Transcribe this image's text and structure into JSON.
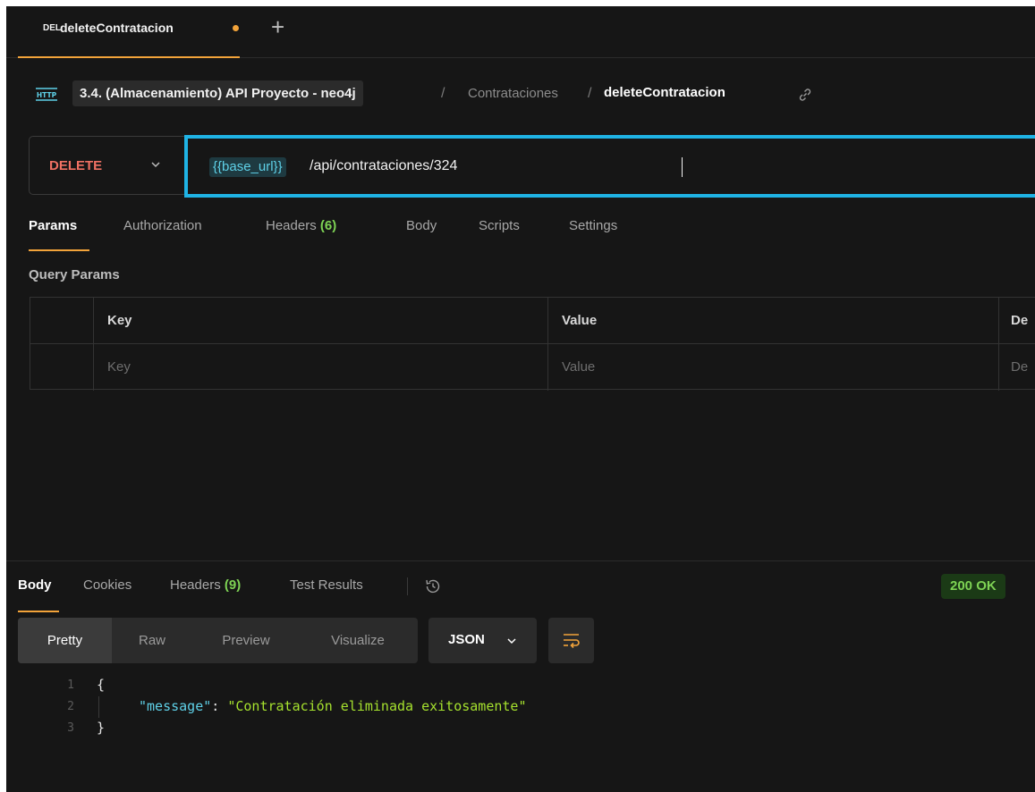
{
  "tab": {
    "method": "DEL",
    "title": "deleteContratacion",
    "new_tab": "+"
  },
  "breadcrumb": {
    "collection": "3.4. (Almacenamiento) API Proyecto - neo4j",
    "separator": "/",
    "folder": "Contrataciones",
    "request": "deleteContratacion"
  },
  "request": {
    "method": "DELETE",
    "url_variable": "{{base_url}}",
    "url_path": "/api/contrataciones/324"
  },
  "request_tabs": [
    {
      "label": "Params"
    },
    {
      "label": "Authorization"
    },
    {
      "label": "Headers",
      "count": "(6)"
    },
    {
      "label": "Body"
    },
    {
      "label": "Scripts"
    },
    {
      "label": "Settings"
    }
  ],
  "query_params": {
    "title": "Query Params",
    "columns": [
      "Key",
      "Value",
      "De"
    ],
    "placeholders": [
      "Key",
      "Value",
      "De"
    ]
  },
  "response": {
    "tabs": [
      {
        "label": "Body"
      },
      {
        "label": "Cookies"
      },
      {
        "label": "Headers",
        "count": "(9)"
      },
      {
        "label": "Test Results"
      }
    ],
    "status": "200 OK",
    "views": [
      "Pretty",
      "Raw",
      "Preview",
      "Visualize"
    ],
    "format": "JSON",
    "code": {
      "line_numbers": [
        "1",
        "2",
        "3"
      ],
      "open_brace": "{",
      "key": "\"message\"",
      "colon": ": ",
      "value": "\"Contratación eliminada exitosamente\"",
      "close_brace": "}"
    }
  },
  "colors": {
    "accent": "#f2a33a",
    "url_focus": "#1fb3e5",
    "method_delete": "#f07163",
    "status_ok": "#7ed354"
  }
}
